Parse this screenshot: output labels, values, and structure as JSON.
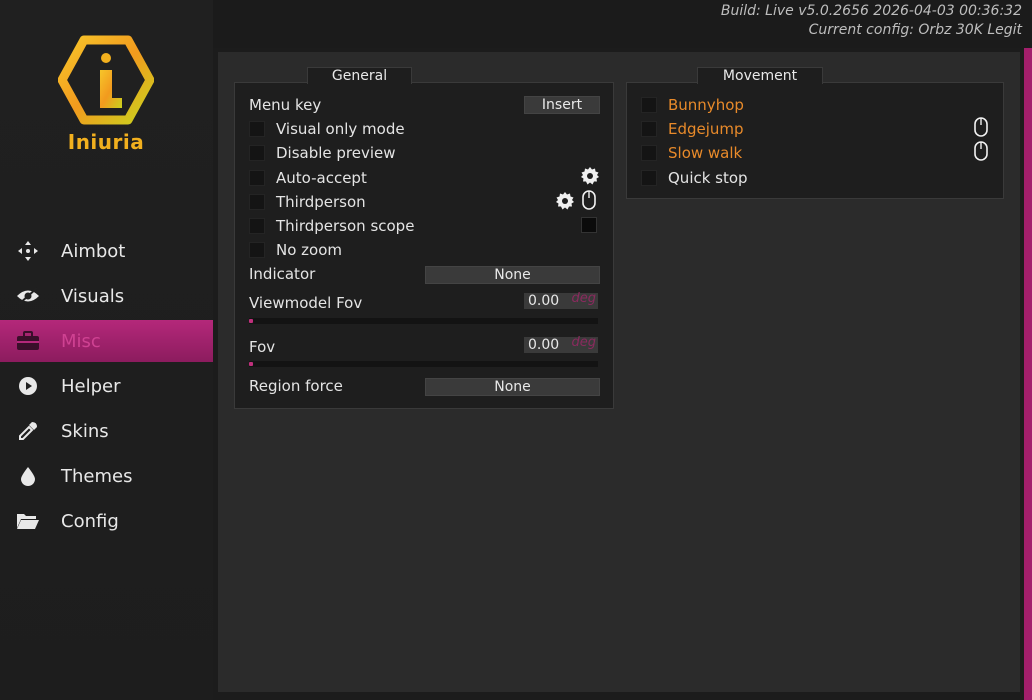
{
  "build_info": {
    "line1": "Build: Live v5.0.2656 2026-04-03 00:36:32",
    "line2": "Current config: Orbz 30K Legit"
  },
  "brand": {
    "name": "Iniuria",
    "logo_color": "#f2b01e"
  },
  "sidebar": {
    "items": [
      {
        "label": "Aimbot",
        "icon": "crosshair-icon"
      },
      {
        "label": "Visuals",
        "icon": "eye-icon"
      },
      {
        "label": "Misc",
        "icon": "briefcase-icon",
        "active": true
      },
      {
        "label": "Helper",
        "icon": "play-circle-icon"
      },
      {
        "label": "Skins",
        "icon": "eyedropper-icon"
      },
      {
        "label": "Themes",
        "icon": "droplet-icon"
      },
      {
        "label": "Config",
        "icon": "folder-open-icon"
      }
    ]
  },
  "colors": {
    "accent": "#b4287a",
    "orange": "#e88a2a"
  },
  "general": {
    "title": "General",
    "menu_key": {
      "label": "Menu key",
      "value": "Insert"
    },
    "visual_only_mode": "Visual only mode",
    "disable_preview": "Disable preview",
    "auto_accept": "Auto-accept",
    "thirdperson": "Thirdperson",
    "thirdperson_scope": "Thirdperson scope",
    "no_zoom": "No zoom",
    "indicator": {
      "label": "Indicator",
      "value": "None"
    },
    "viewmodel_fov": {
      "label": "Viewmodel Fov",
      "value": "0.00",
      "unit": "deg"
    },
    "fov": {
      "label": "Fov",
      "value": "0.00",
      "unit": "deg"
    },
    "region_force": {
      "label": "Region force",
      "value": "None"
    }
  },
  "movement": {
    "title": "Movement",
    "bunnyhop": "Bunnyhop",
    "edgejump": "Edgejump",
    "slow_walk": "Slow walk",
    "quick_stop": "Quick stop"
  }
}
